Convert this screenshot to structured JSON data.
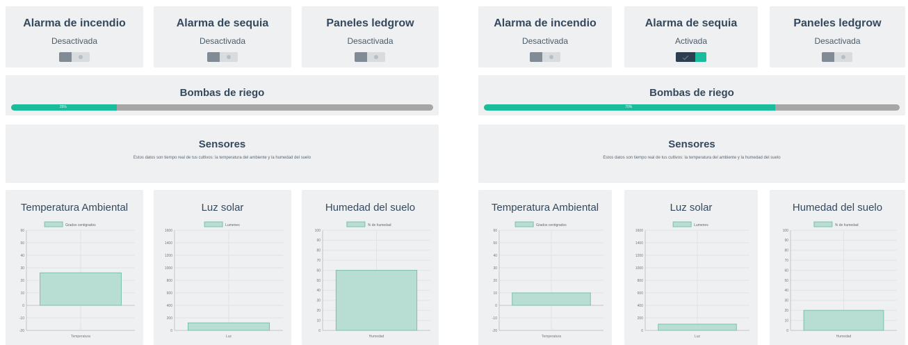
{
  "panels": [
    {
      "alarms": [
        {
          "title": "Alarma de incendio",
          "status": "Desactivada",
          "state": "off"
        },
        {
          "title": "Alarma de sequia",
          "status": "Desactivada",
          "state": "off"
        },
        {
          "title": "Paneles ledgrow",
          "status": "Desactivada",
          "state": "off"
        }
      ],
      "pump": {
        "title": "Bombas de riego",
        "progress_percent": 25,
        "progress_label": "25%"
      },
      "sensors": {
        "title": "Sensores",
        "description": "Estos datos son tiempo real de tus cultivos: la temperatura del ambiente y la humedad del suelo"
      }
    },
    {
      "alarms": [
        {
          "title": "Alarma de incendio",
          "status": "Desactivada",
          "state": "off"
        },
        {
          "title": "Alarma de sequia",
          "status": "Activada",
          "state": "on"
        },
        {
          "title": "Paneles ledgrow",
          "status": "Desactivada",
          "state": "off"
        }
      ],
      "pump": {
        "title": "Bombas de riego",
        "progress_percent": 70,
        "progress_label": "70%"
      },
      "sensors": {
        "title": "Sensores",
        "description": "Estos datos son tiempo real de tus cultivos: la temperatura del ambiente y la humedad del suelo"
      }
    }
  ],
  "chart_data": [
    {
      "panel": 0,
      "type": "bar",
      "title": "Temperatura Ambiental",
      "legend": "Grados centigrados",
      "categories": [
        "Temperatura"
      ],
      "values": [
        26
      ],
      "ylim": [
        -20,
        60
      ],
      "yticks": [
        -20,
        -10,
        0,
        10,
        20,
        30,
        40,
        50,
        60
      ],
      "color": "#b8ddd3",
      "border": "#7bbfae"
    },
    {
      "panel": 0,
      "type": "bar",
      "title": "Luz solar",
      "legend": "Lumenes",
      "categories": [
        "Luz"
      ],
      "values": [
        120
      ],
      "ylim": [
        0,
        1600
      ],
      "yticks": [
        0,
        200,
        400,
        600,
        800,
        1000,
        1200,
        1400,
        1600
      ],
      "color": "#b8ddd3",
      "border": "#7bbfae"
    },
    {
      "panel": 0,
      "type": "bar",
      "title": "Humedad del suelo",
      "legend": "% de humedad",
      "categories": [
        "Humedad"
      ],
      "values": [
        60
      ],
      "ylim": [
        0,
        100
      ],
      "yticks": [
        0,
        10,
        20,
        30,
        40,
        50,
        60,
        70,
        80,
        90,
        100
      ],
      "color": "#b8ddd3",
      "border": "#7bbfae"
    },
    {
      "panel": 1,
      "type": "bar",
      "title": "Temperatura Ambiental",
      "legend": "Grados centigrados",
      "categories": [
        "Temperatura"
      ],
      "values": [
        10
      ],
      "ylim": [
        -20,
        60
      ],
      "yticks": [
        -20,
        -10,
        0,
        10,
        20,
        30,
        40,
        50,
        60
      ],
      "color": "#b8ddd3",
      "border": "#7bbfae"
    },
    {
      "panel": 1,
      "type": "bar",
      "title": "Luz solar",
      "legend": "Lumenes",
      "categories": [
        "Luz"
      ],
      "values": [
        100
      ],
      "ylim": [
        0,
        1600
      ],
      "yticks": [
        0,
        200,
        400,
        600,
        800,
        1000,
        1200,
        1400,
        1600
      ],
      "color": "#b8ddd3",
      "border": "#7bbfae"
    },
    {
      "panel": 1,
      "type": "bar",
      "title": "Humedad del suelo",
      "legend": "% de humedad",
      "categories": [
        "Humedad"
      ],
      "values": [
        20
      ],
      "ylim": [
        0,
        100
      ],
      "yticks": [
        0,
        10,
        20,
        30,
        40,
        50,
        60,
        70,
        80,
        90,
        100
      ],
      "color": "#b8ddd3",
      "border": "#7bbfae"
    }
  ]
}
